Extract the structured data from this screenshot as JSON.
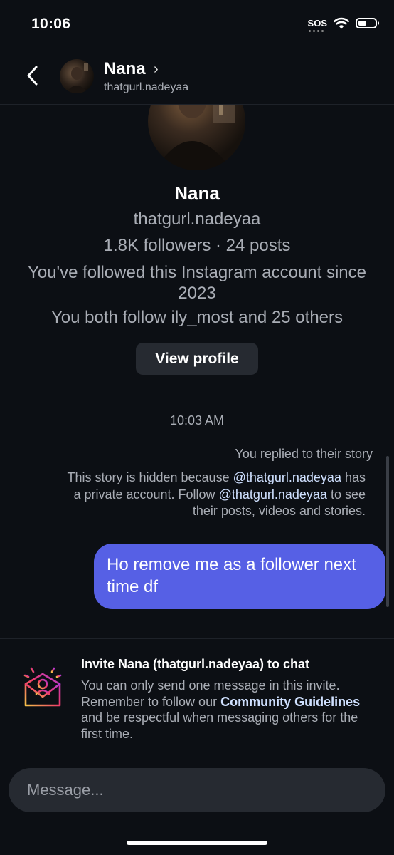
{
  "status_bar": {
    "time": "10:06",
    "sos": "SOS"
  },
  "header": {
    "name": "Nana",
    "username": "thatgurl.nadeyaa"
  },
  "profile": {
    "name": "Nana",
    "username": "thatgurl.nadeyaa",
    "stats": "1.8K followers · 24 posts",
    "followed_since": "You've followed this Instagram account since 2023",
    "mutual": "You both follow ily_most and 25 others",
    "view_profile_label": "View profile"
  },
  "chat": {
    "timestamp": "10:03 AM",
    "reply_note": "You replied to their story",
    "hidden_note": {
      "part1": "This story is hidden because ",
      "mention1": "@thatgurl.nadeyaa",
      "part2": " has a private account. Follow ",
      "mention2": "@thatgurl.nadeyaa",
      "part3": " to see their posts, videos and stories."
    },
    "sent_message": "Ho remove me as a follower next time df"
  },
  "invite": {
    "title": "Invite Nana (thatgurl.nadeyaa) to chat",
    "body1": "You can only send one message in this invite. Remember to follow our ",
    "link": "Community Guidelines",
    "body2": " and be respectful when messaging others for the first time."
  },
  "composer": {
    "placeholder": "Message..."
  },
  "colors": {
    "background": "#0c0f14",
    "bubble": "#5660e5",
    "link": "#cfe0ff",
    "secondary_text": "#a9adb5"
  }
}
